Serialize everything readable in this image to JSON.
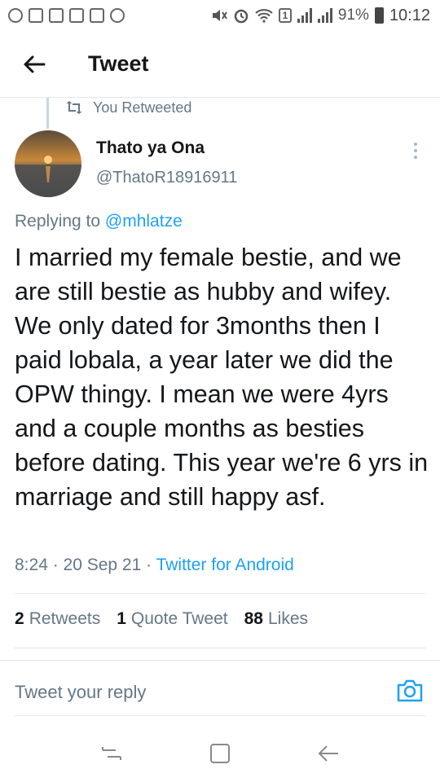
{
  "status_bar": {
    "battery": "91%",
    "time": "10:12",
    "sim_badge": "1"
  },
  "header": {
    "title": "Tweet"
  },
  "retweet_context": {
    "label": "You Retweeted"
  },
  "author": {
    "name": "Thato ya Ona",
    "handle": "@ThatoR18916911"
  },
  "replying": {
    "prefix": "Replying to ",
    "mention": "@mhlatze"
  },
  "tweet": {
    "text": "I married my female bestie, and we are still bestie as hubby and wifey. We only dated for 3months then I paid lobala, a year later we did the OPW thingy. I mean we were 4yrs and a couple months as besties before dating. This year we're 6 yrs in marriage and still happy asf.",
    "time": "8:24 · 20 Sep 21 · ",
    "source": "Twitter for Android"
  },
  "stats": {
    "retweets_count": "2",
    "retweets_label": "Retweets",
    "quotes_count": "1",
    "quotes_label": "Quote Tweet",
    "likes_count": "88",
    "likes_label": "Likes"
  },
  "reply": {
    "placeholder": "Tweet your reply"
  },
  "colors": {
    "accent": "#1da1f2",
    "secondary_text": "#657786",
    "primary_text": "#14171a"
  }
}
